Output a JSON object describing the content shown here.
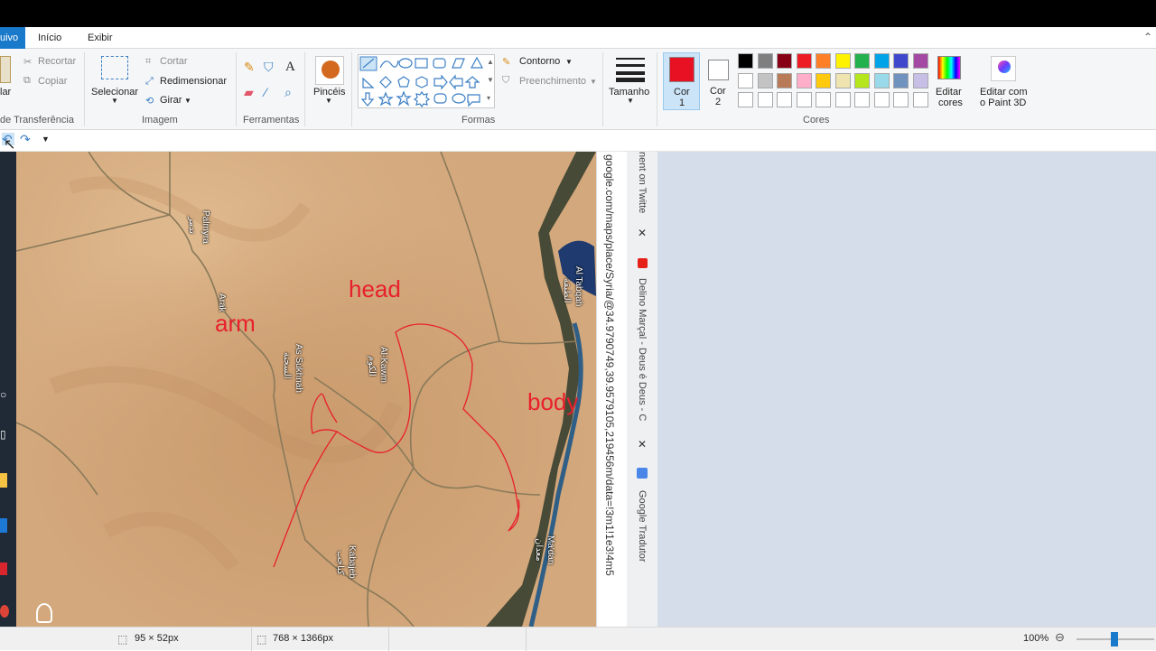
{
  "tabs": {
    "file": "uivo",
    "home": "Início",
    "view": "Exibir"
  },
  "clipboard": {
    "paste": "lar",
    "cut": "Recortar",
    "copy": "Copiar",
    "group": "de Transferência"
  },
  "image": {
    "select": "Selecionar",
    "crop": "Cortar",
    "resize": "Redimensionar",
    "rotate": "Girar",
    "group": "Imagem"
  },
  "tools": {
    "group": "Ferramentas"
  },
  "brushes": {
    "label": "Pincéis"
  },
  "shapes": {
    "outline": "Contorno",
    "fill": "Preenchimento",
    "group": "Formas"
  },
  "size": {
    "label": "Tamanho"
  },
  "colors": {
    "color1a": "Cor",
    "color1b": "1",
    "color2a": "Cor",
    "color2b": "2",
    "edit": "Editar",
    "edit2": "cores",
    "group": "Cores",
    "paint3d_a": "Editar com",
    "paint3d_b": "o Paint 3D",
    "color1_value": "#e81123",
    "color2_value": "#ffffff",
    "palette_row1": [
      "#000000",
      "#7f7f7f",
      "#880015",
      "#ed1c24",
      "#ff7f27",
      "#fff200",
      "#22b14c",
      "#00a2e8",
      "#3f48cc",
      "#a349a4"
    ],
    "palette_row2": [
      "#ffffff",
      "#c3c3c3",
      "#b97a57",
      "#ffaec9",
      "#ffc90e",
      "#efe4b0",
      "#b5e61d",
      "#99d9ea",
      "#7092be",
      "#c8bfe7"
    ]
  },
  "map": {
    "labels": {
      "head": "head",
      "arm": "arm",
      "body": "body"
    },
    "places": {
      "palmyra": "Palmyra",
      "palmyra_ar": "تدمر",
      "arak": "Arak",
      "sukhnah": "As Sukhnah",
      "sukhnah_ar": "السخنة",
      "kawm": "Al-Kawm",
      "kawm_ar": "الكوم",
      "tabqah": "Al Tabqah",
      "tabqah_ar": "الطبقة",
      "kabajeb": "Kabajeb",
      "kabajeb_ar": "كباجب",
      "madan": "Ma'dan",
      "madan_ar": "معدان"
    }
  },
  "browser": {
    "url": "google.com/maps/place/Syria/@34.9790749,39.9579105,219456m/data=!3m1!1e3!4m5",
    "tab1": "nent on Twitte",
    "tab2": "Delino Marçal - Deus é Deus - C",
    "tab3": "Google Tradutor"
  },
  "status": {
    "selection": "95 × 52px",
    "canvas": "768 × 1366px",
    "zoom": "100%"
  }
}
